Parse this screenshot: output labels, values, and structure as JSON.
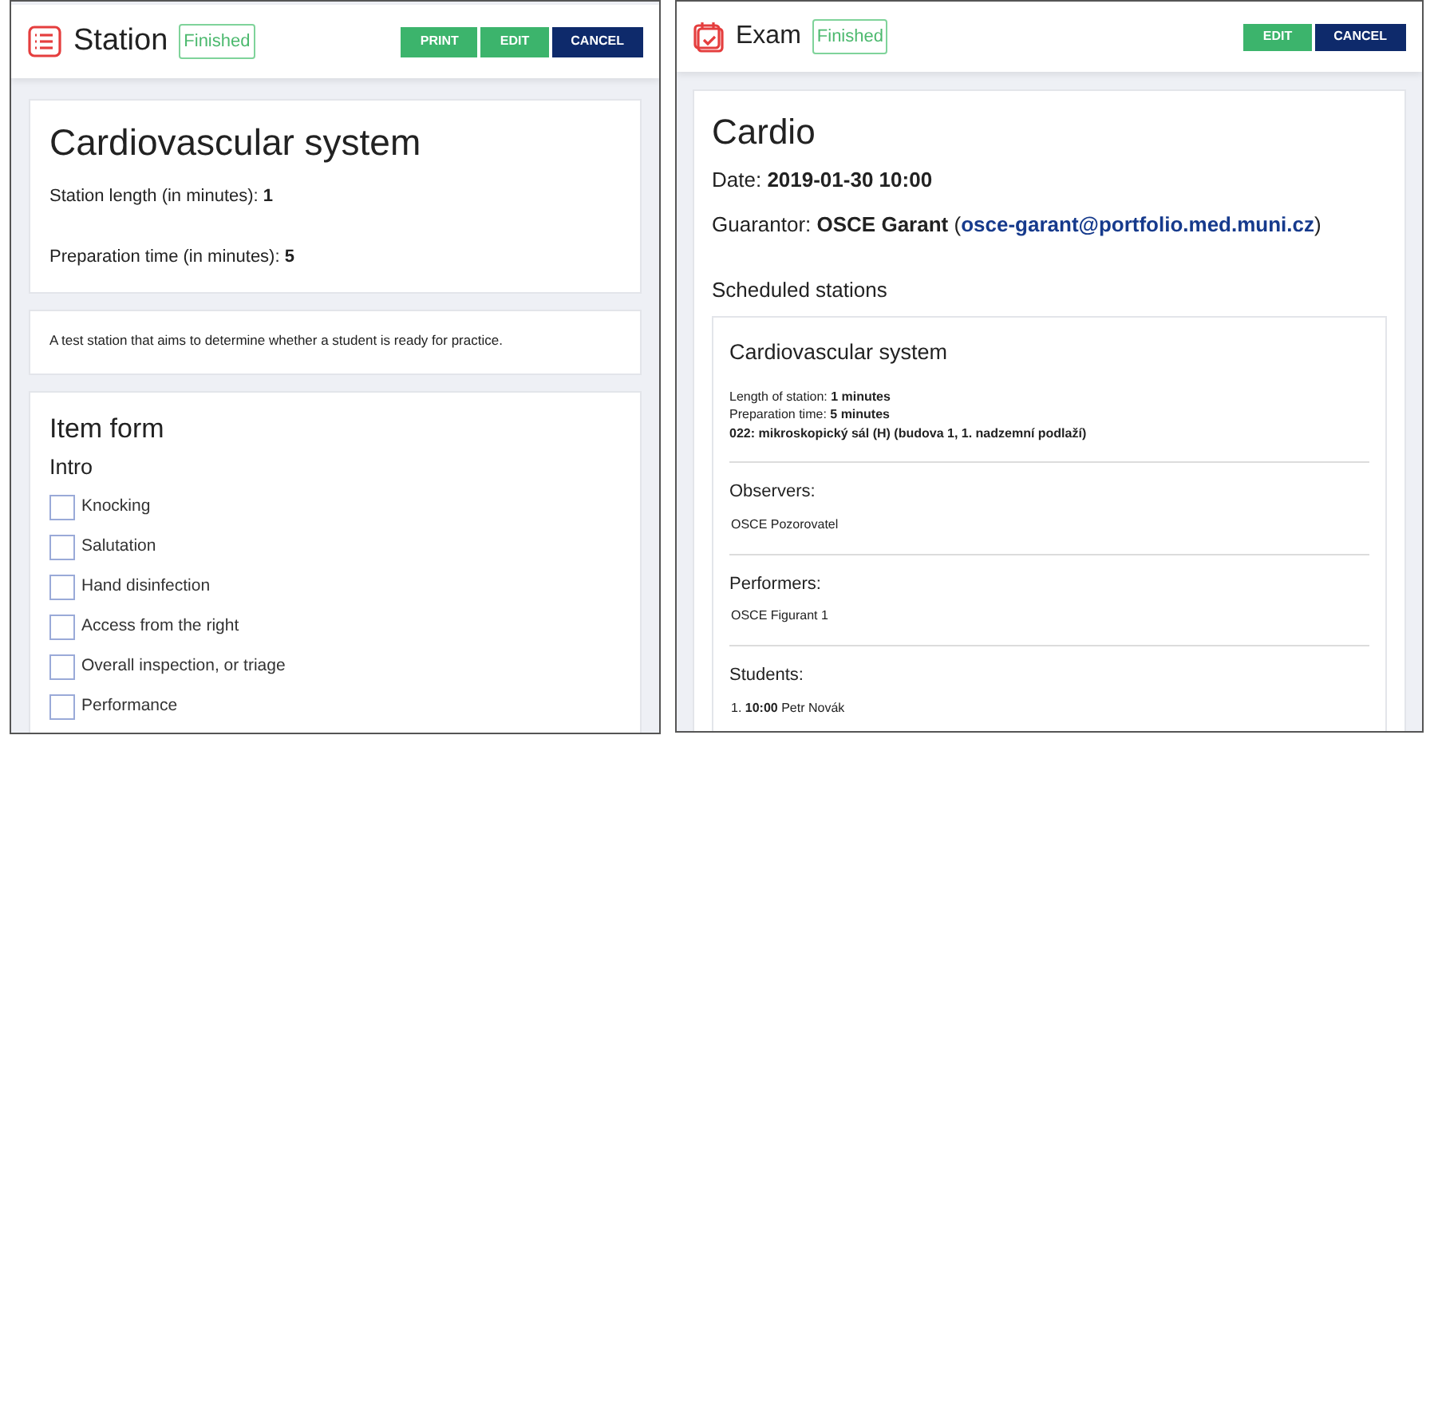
{
  "station": {
    "title": "Station",
    "status": "Finished",
    "buttons": [
      {
        "label": "PRINT",
        "kind": "success"
      },
      {
        "label": "EDIT",
        "kind": "success"
      },
      {
        "label": "CANCEL",
        "kind": "navy"
      }
    ],
    "name": "Cardiovascular system",
    "fields": [
      "Station length (in minutes): **1**",
      "Preparation time (in minutes): **5**"
    ],
    "description": "A test station that aims to determine whether a student is ready for practice.",
    "form": {
      "title": "Item form",
      "section": "Intro",
      "items": [
        {
          "label": "Knocking",
          "checked": false
        },
        {
          "label": "Salutation",
          "checked": false
        },
        {
          "label": "Hand disinfection",
          "checked": false
        },
        {
          "label": "Access from the right",
          "checked": false
        },
        {
          "label": "Overall inspection, or triage",
          "checked": false
        },
        {
          "label": "Performance",
          "checked": false
        }
      ]
    }
  },
  "exam": {
    "title": "Exam",
    "status": "Finished",
    "buttons": [
      {
        "label": "EDIT",
        "kind": "success"
      },
      {
        "label": "CANCEL",
        "kind": "navy"
      }
    ],
    "name": "Cardio",
    "date": "Date: **2019-01-30 10:00**",
    "guarantor": {
      "text": "Guarantor: **OSCE Garant** (",
      "email": "osce-garant@portfolio.med.muni.cz",
      "after": ")"
    },
    "scheduled_title": "Scheduled stations",
    "station": {
      "name": "Cardiovascular system",
      "details": [
        "Length of station: **1 minutes**",
        "Preparation time: **5 minutes**",
        "**022: mikroskopický sál (H) (budova 1, 1. nadzemní podlaží)**"
      ],
      "sections": [
        {
          "title": "Observers:",
          "items": [
            "OSCE Pozorovatel"
          ]
        },
        {
          "title": "Performers:",
          "items": [
            "OSCE Figurant 1"
          ]
        },
        {
          "title": "Students:",
          "items": [
            "1. **10:00** Petr Novák"
          ]
        }
      ]
    }
  }
}
